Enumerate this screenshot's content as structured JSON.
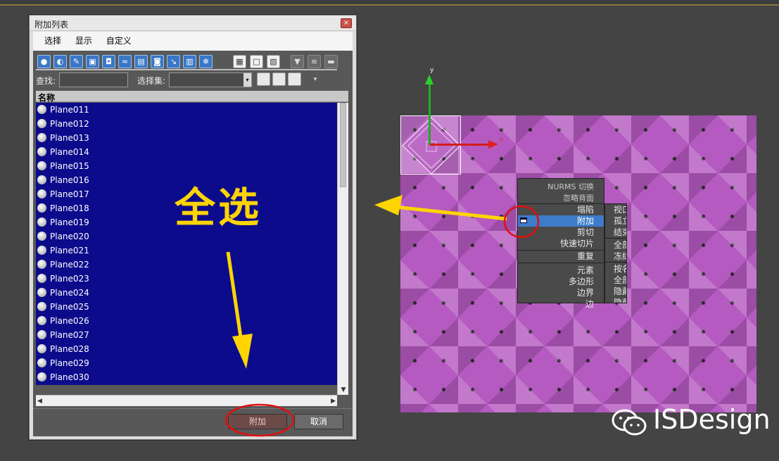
{
  "dialog": {
    "title": "附加列表",
    "close": "×",
    "menu": [
      "选择",
      "显示",
      "自定义"
    ],
    "toolbar_icons": [
      "geometry-icon",
      "shape-icon",
      "light-icon",
      "camera-icon",
      "helper-icon",
      "spacewarp-icon",
      "group-icon",
      "xref-icon",
      "bone-icon",
      "container-icon",
      "frozen-icon",
      "select-all-icon",
      "select-none-icon",
      "select-invert-icon",
      "filter-icon",
      "sort-icon",
      "display-icon"
    ],
    "find_label": "查找:",
    "selection_set_label": "选择集:",
    "dropdown_arrow": "▾",
    "column_header": "名称",
    "items": [
      "Plane011",
      "Plane012",
      "Plane013",
      "Plane014",
      "Plane015",
      "Plane016",
      "Plane017",
      "Plane018",
      "Plane019",
      "Plane020",
      "Plane021",
      "Plane022",
      "Plane023",
      "Plane024",
      "Plane025",
      "Plane026",
      "Plane027",
      "Plane028",
      "Plane029",
      "Plane030"
    ],
    "attach_button": "附加",
    "cancel_button": "取消"
  },
  "annotation": {
    "select_all_text": "全选"
  },
  "viewport": {
    "axis_y": "y",
    "axis_x": "x",
    "quad_left": [
      "NURMS 切换",
      "忽略背面",
      "塌陷",
      "附加",
      "剪切",
      "快速切片",
      "重复",
      "元素",
      "多边形",
      "边界",
      "边"
    ],
    "quad_right": [
      "视口",
      "孤立",
      "结束",
      "全部",
      "冻结",
      "按名",
      "全部",
      "隐藏",
      "隐藏"
    ]
  },
  "watermark": "ISDesign",
  "colors": {
    "list_bg": "#0b0b8c",
    "highlight": "#3c7cc9",
    "annotation_yellow": "#ffd400",
    "annotation_red": "#e01010",
    "object": "#b45ac0"
  }
}
